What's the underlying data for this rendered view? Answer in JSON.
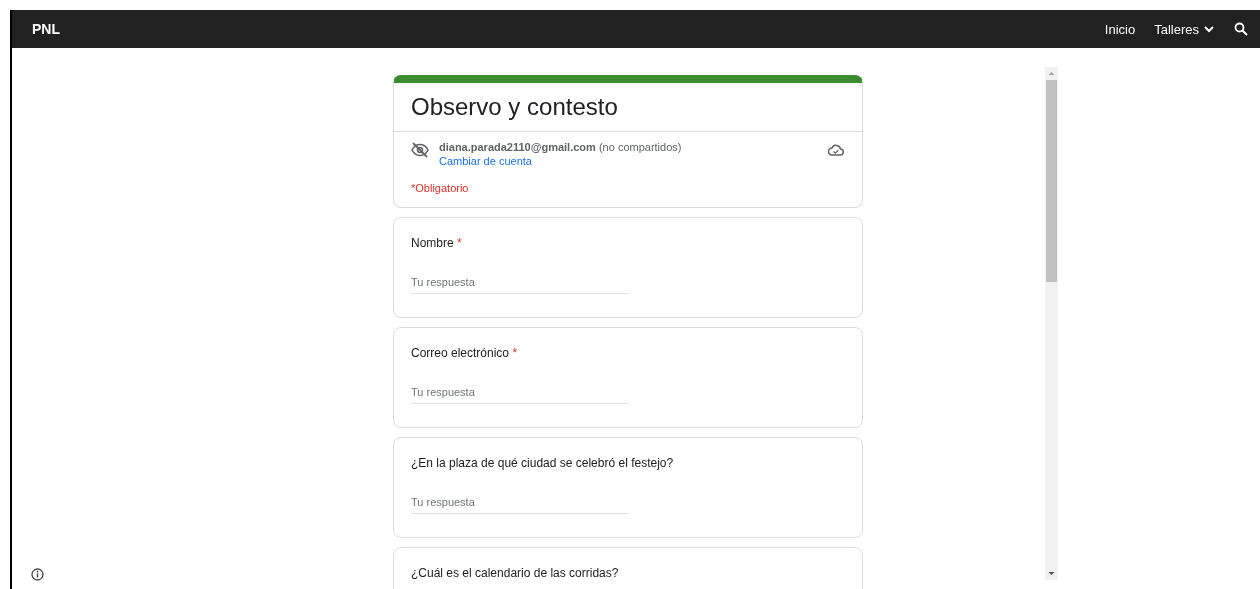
{
  "topbar": {
    "brand": "PNL",
    "nav": [
      {
        "label": "Inicio",
        "kind": "link"
      },
      {
        "label": "Talleres",
        "kind": "dropdown"
      }
    ]
  },
  "form": {
    "title": "Observo y contesto",
    "account_email": "diana.parada2110@gmail.com",
    "account_note": "(no compartidos)",
    "switch_account": "Cambiar de cuenta",
    "required_note": "*Obligatorio",
    "required_marker": "*",
    "questions": [
      {
        "label": "Nombre",
        "required": true,
        "placeholder": "Tu respuesta"
      },
      {
        "label": "Correo electrónico",
        "required": true,
        "placeholder": "Tu respuesta"
      },
      {
        "label": "¿En la plaza de qué ciudad se celebró el festejo?",
        "required": false,
        "placeholder": "Tu respuesta"
      },
      {
        "label": "¿Cuál es el calendario de las corridas?",
        "required": false
      }
    ]
  }
}
